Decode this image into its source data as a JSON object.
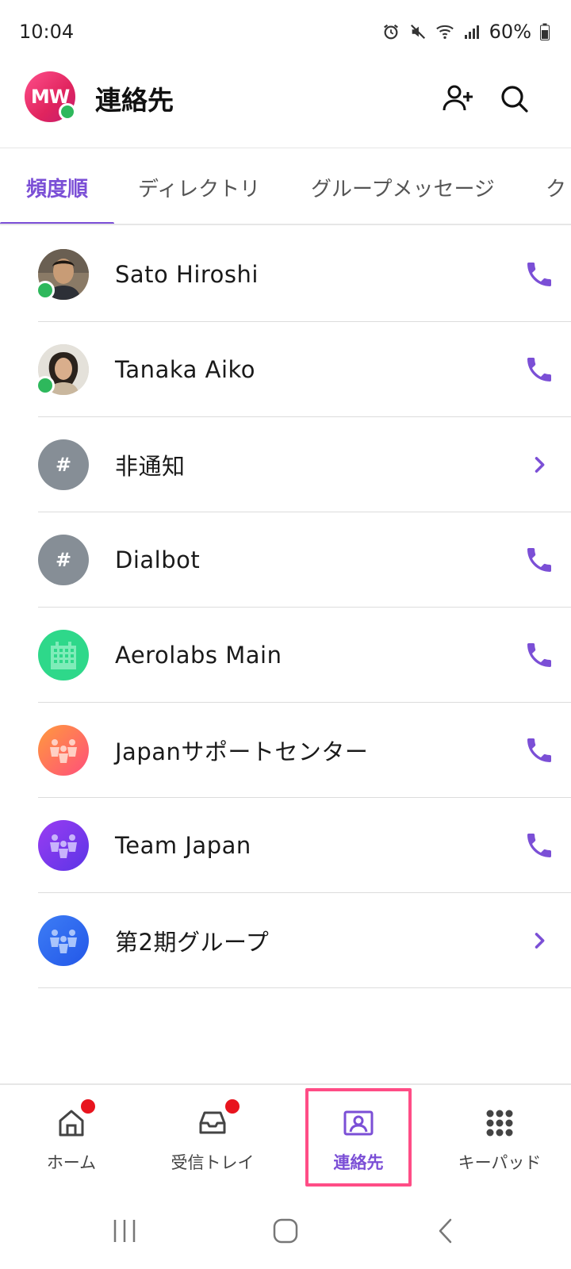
{
  "status_bar": {
    "time": "10:04",
    "battery": "60%",
    "icons": [
      "alarm-icon",
      "mute-icon",
      "wifi-icon",
      "signal-icon",
      "battery-icon"
    ]
  },
  "header": {
    "avatar_initials": "MW",
    "title": "連絡先",
    "actions": [
      "add-contact-icon",
      "search-icon"
    ]
  },
  "tabs": [
    {
      "label": "頻度順",
      "active": true
    },
    {
      "label": "ディレクトリ",
      "active": false
    },
    {
      "label": "グループメッセージ",
      "active": false
    },
    {
      "label": "ク",
      "active": false
    }
  ],
  "contacts": [
    {
      "name": "Sato Hiroshi",
      "avatar": "photo",
      "online": true,
      "action": "phone-icon"
    },
    {
      "name": "Tanaka Aiko",
      "avatar": "photo",
      "online": true,
      "action": "phone-icon"
    },
    {
      "name": "非通知",
      "avatar": "#",
      "online": false,
      "action": "chevron-right-icon"
    },
    {
      "name": "Dialbot",
      "avatar": "#",
      "online": false,
      "action": "phone-icon"
    },
    {
      "name": "Aerolabs Main",
      "avatar": "building-icon",
      "online": false,
      "action": "phone-icon"
    },
    {
      "name": "Japanサポートセンター",
      "avatar": "group-icon",
      "online": false,
      "action": "phone-icon"
    },
    {
      "name": "Team Japan",
      "avatar": "group-icon",
      "online": false,
      "action": "phone-icon"
    },
    {
      "name": "第2期グループ",
      "avatar": "group-icon",
      "online": false,
      "action": "chevron-right-icon"
    }
  ],
  "bottom_nav": [
    {
      "label": "ホーム",
      "icon": "home-icon",
      "badge": true,
      "active": false
    },
    {
      "label": "受信トレイ",
      "icon": "inbox-icon",
      "badge": true,
      "active": false
    },
    {
      "label": "連絡先",
      "icon": "contacts-icon",
      "badge": false,
      "active": true
    },
    {
      "label": "キーパッド",
      "icon": "keypad-icon",
      "badge": false,
      "active": false
    }
  ],
  "colors": {
    "accent": "#7b4fd6",
    "online": "#2eb85c",
    "badge": "#e8141e",
    "highlight": "#ff4d86",
    "hash_avatar": "#868e96",
    "building_avatar": "#2ed88a",
    "support_avatar": "#ff5a6e",
    "team_avatar": "#7b3ff2",
    "group2_avatar": "#2e6cf2"
  }
}
